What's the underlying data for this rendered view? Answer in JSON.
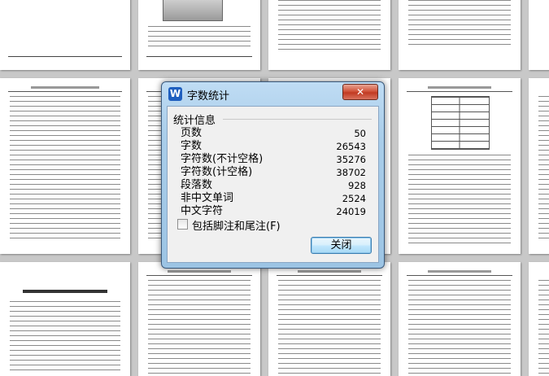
{
  "dialog": {
    "title": "字数统计",
    "app_icon_letter": "W",
    "group_label": "统计信息",
    "stats": [
      {
        "label": "页数",
        "value": "50"
      },
      {
        "label": "字数",
        "value": "26543"
      },
      {
        "label": "字符数(不计空格)",
        "value": "35276"
      },
      {
        "label": "字符数(计空格)",
        "value": "38702"
      },
      {
        "label": "段落数",
        "value": "928"
      },
      {
        "label": "非中文单词",
        "value": "2524"
      },
      {
        "label": "中文字符",
        "value": "24019"
      }
    ],
    "checkbox_label": "包括脚注和尾注(F)",
    "checkbox_checked": false,
    "ok_label": "关闭",
    "close_glyph": "✕"
  },
  "colors": {
    "dialog_frame": "#a9cde9",
    "close_button": "#c13a22",
    "button_border": "#3c7fb1",
    "workspace_background": "#c8c8c8"
  }
}
